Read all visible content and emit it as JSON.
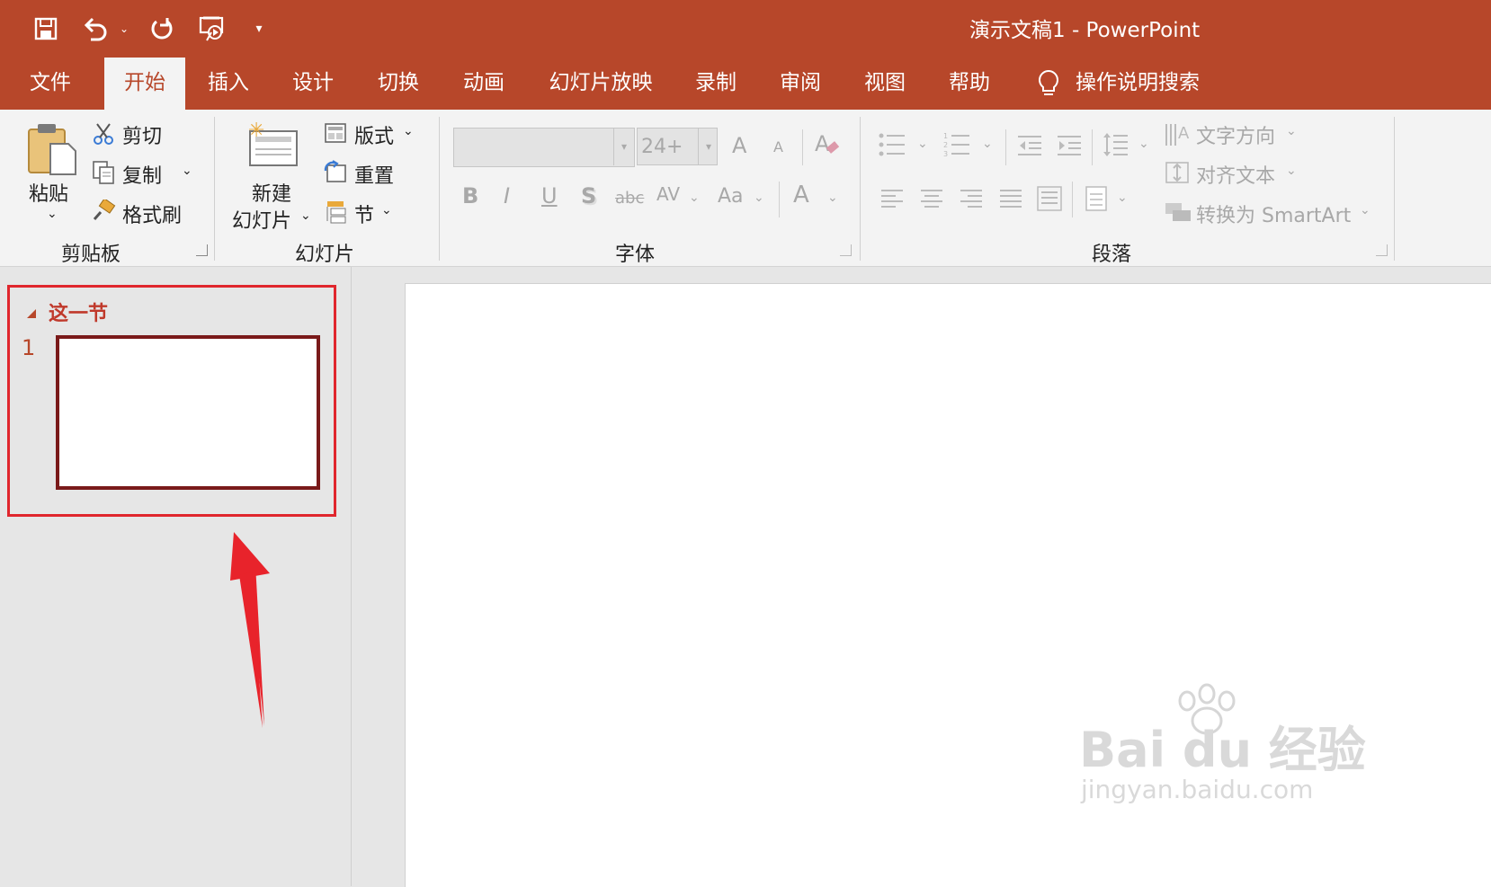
{
  "window": {
    "title": "演示文稿1  -  PowerPoint"
  },
  "tabs": [
    "文件",
    "开始",
    "插入",
    "设计",
    "切换",
    "动画",
    "幻灯片放映",
    "录制",
    "审阅",
    "视图",
    "帮助"
  ],
  "tell_me": "操作说明搜索",
  "clipboard": {
    "paste": "粘贴",
    "cut": "剪切",
    "copy": "复制",
    "format_painter": "格式刷",
    "group": "剪贴板"
  },
  "slides_group": {
    "new_slide_1": "新建",
    "new_slide_2": "幻灯片",
    "layout": "版式",
    "reset": "重置",
    "section": "节",
    "group": "幻灯片"
  },
  "font_group": {
    "size": "24+",
    "group": "字体",
    "bold": "B",
    "italic": "I",
    "underline": "U",
    "shadow": "S",
    "strike": "abc",
    "spacing": "AV",
    "case": "Aa",
    "color": "A",
    "grow": "A",
    "shrink": "A"
  },
  "paragraph_group": {
    "text_direction": "文字方向",
    "align_text": "对齐文本",
    "smartart": "转换为 SmartArt",
    "group": "段落"
  },
  "slide_pane": {
    "section_name": "这一节",
    "slide_number": "1"
  },
  "watermark": {
    "brand": "Bai  du 经验",
    "url": "jingyan.baidu.com"
  },
  "colors": {
    "accent": "#b7472a",
    "highlight": "#e0262d",
    "arrow": "#e8232b"
  }
}
